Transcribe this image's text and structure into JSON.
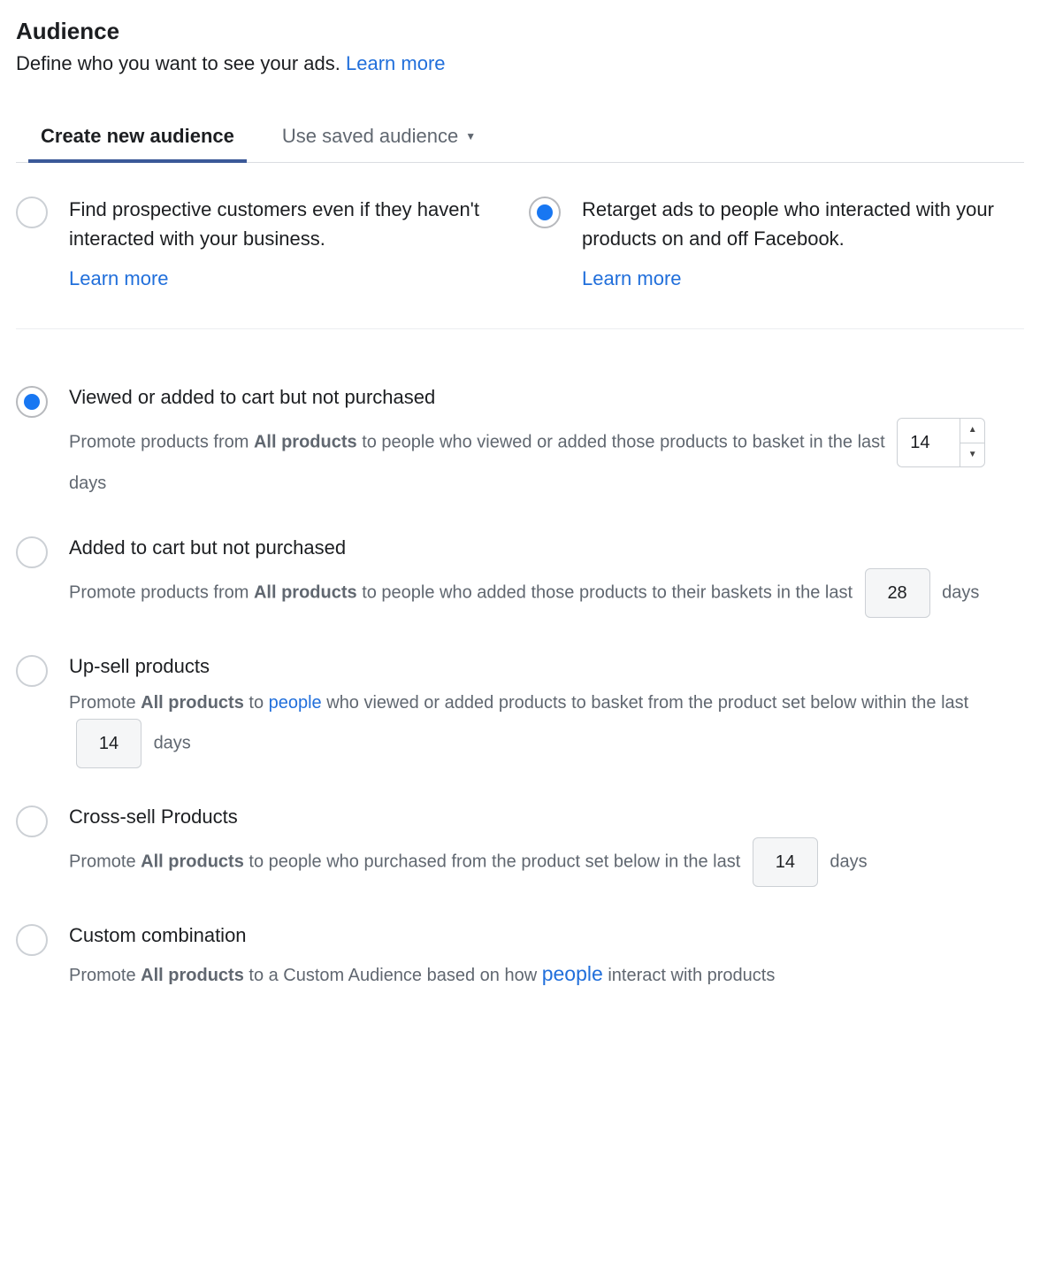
{
  "header": {
    "title": "Audience",
    "subtitle_prefix": "Define who you want to see your ads. ",
    "learn_more": "Learn more"
  },
  "tabs": {
    "create": "Create new audience",
    "saved": "Use saved audience"
  },
  "top_options": {
    "prospect": {
      "text": "Find prospective customers even if they haven't interacted with your business.",
      "learn_more": "Learn more"
    },
    "retarget": {
      "text": "Retarget ads to people who interacted with your products on and off Facebook.",
      "learn_more": "Learn more"
    }
  },
  "opts": {
    "o1": {
      "title": "Viewed or added to cart but not purchased",
      "d_pre": "Promote products from ",
      "all": "All products",
      "d_mid": " to people who viewed or added those products to basket in the last ",
      "days_val": "14",
      "d_end": " days"
    },
    "o2": {
      "title": "Added to cart but not purchased",
      "d_pre": "Promote products from ",
      "all": "All products",
      "d_mid": " to people who added those products to their baskets in the last ",
      "days_val": "28",
      "d_end": " days"
    },
    "o3": {
      "title": "Up-sell products",
      "d_pre": "Promote ",
      "all": "All products",
      "d_mid1": " to ",
      "people": "people",
      "d_mid2": " who viewed or added products to basket from the product set below within the last ",
      "days_val": "14",
      "d_end": " days"
    },
    "o4": {
      "title": "Cross-sell Products",
      "d_pre": "Promote ",
      "all": "All products",
      "d_mid": " to people who purchased from the product set below in the last ",
      "days_val": "14",
      "d_end": " days"
    },
    "o5": {
      "title": "Custom combination",
      "d_pre": "Promote ",
      "all": "All products",
      "d_mid1": " to a Custom Audience based on how ",
      "people": "people",
      "d_mid2": " interact with products"
    }
  }
}
